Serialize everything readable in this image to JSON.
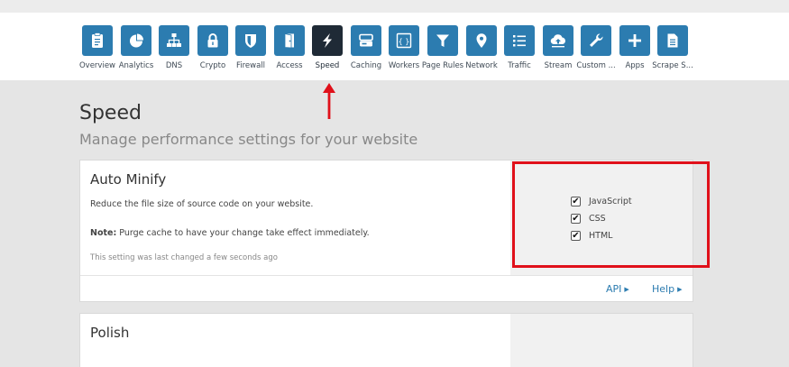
{
  "nav": {
    "items": [
      {
        "label": "Overview",
        "icon": "clipboard-icon"
      },
      {
        "label": "Analytics",
        "icon": "pie-chart-icon"
      },
      {
        "label": "DNS",
        "icon": "network-tree-icon"
      },
      {
        "label": "Crypto",
        "icon": "lock-icon"
      },
      {
        "label": "Firewall",
        "icon": "shield-icon"
      },
      {
        "label": "Access",
        "icon": "door-icon"
      },
      {
        "label": "Speed",
        "icon": "lightning-icon",
        "active": true
      },
      {
        "label": "Caching",
        "icon": "server-icon"
      },
      {
        "label": "Workers",
        "icon": "code-braces-icon"
      },
      {
        "label": "Page Rules",
        "icon": "filter-icon"
      },
      {
        "label": "Network",
        "icon": "location-pin-icon"
      },
      {
        "label": "Traffic",
        "icon": "list-icon"
      },
      {
        "label": "Stream",
        "icon": "cloud-upload-icon"
      },
      {
        "label": "Custom ...",
        "icon": "wrench-icon"
      },
      {
        "label": "Apps",
        "icon": "plus-icon"
      },
      {
        "label": "Scrape S...",
        "icon": "document-icon"
      }
    ]
  },
  "page": {
    "title": "Speed",
    "subtitle": "Manage performance settings for your website"
  },
  "auto_minify": {
    "title": "Auto Minify",
    "description": "Reduce the file size of source code on your website.",
    "note_label": "Note:",
    "note_text": " Purge cache to have your change take effect immediately.",
    "last_changed": "This setting was last changed a few seconds ago",
    "options": [
      {
        "label": "JavaScript",
        "checked": true
      },
      {
        "label": "CSS",
        "checked": true
      },
      {
        "label": "HTML",
        "checked": true
      }
    ],
    "api_link": "API",
    "help_link": "Help"
  },
  "polish": {
    "title": "Polish"
  },
  "colors": {
    "accent": "#2c7cb0",
    "active_icon": "#1f2a36",
    "highlight": "#e0101a"
  }
}
